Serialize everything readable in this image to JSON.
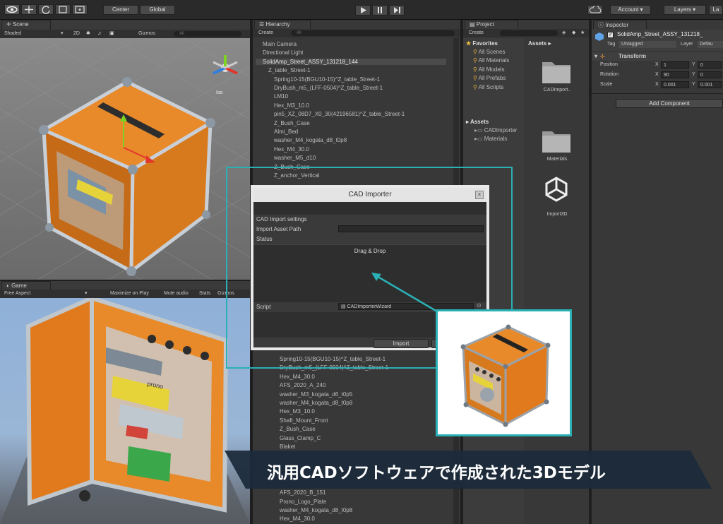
{
  "toolbar": {
    "pivot_label": "Center",
    "space_label": "Global",
    "account_label": "Account",
    "layers_label": "Layers",
    "layout_label": "La"
  },
  "scene": {
    "tab_label": "Scene",
    "shading_label": "Shaded",
    "mode_2d_label": "2D",
    "gizmos_label": "Gizmos",
    "search_placeholder": "All",
    "persp_label": "Iso"
  },
  "game": {
    "tab_label": "Game",
    "aspect_label": "Free Aspect",
    "maximize_label": "Maximize on Play",
    "mute_label": "Mute audio",
    "stats_label": "Stats",
    "gizmos_label": "Gizmos"
  },
  "hierarchy": {
    "tab_label": "Hierarchy",
    "create_label": "Create",
    "search_placeholder": "All",
    "items_top": [
      "Main Camera",
      "Directional Light",
      "SolidAmp_Street_ASSY_131218_144",
      "Z_table_Street-1",
      "Spring10-15(BGU10-15)^Z_table_Street-1",
      "DryBush_m5_(LFF-0504)^Z_table_Street-1",
      "LM10",
      "Hex_M3_10.0",
      "pin5_XZ_08D7_X0_30(42196581)^Z_table_Street-1",
      "Z_Bush_Case",
      "Almi_Bed",
      "washer_M4_kogata_d8_t0p8",
      "Hex_M4_30.0",
      "washer_M5_d10",
      "Z_Bush_Case",
      "Z_anchor_Vertical"
    ],
    "items_bottom": [
      "Spring10-15(BGU10-15)^Z_table_Street-1",
      "DryBush_m5_(LFF-0504)^Z_table_Street-1",
      "Hex_M4_30.0",
      "AFS_2020_A_240",
      "washer_M3_kogata_d6_t0p5",
      "washer_M4_kogata_d8_t0p8",
      "Hex_M3_10.0",
      "Shaft_Mount_Front",
      "Z_Bush_Case",
      "Glass_Clamp_C",
      "Blaket",
      "AFS_2020_B_151",
      "Prono_Logo_Plate",
      "washer_M4_kogata_d8_t0p8",
      "Hex_M4_30.0"
    ]
  },
  "project": {
    "tab_label": "Project",
    "create_label": "Create",
    "favorites_label": "Favorites",
    "favorites": [
      "All Scenes",
      "All Materials",
      "All Models",
      "All Prefabs",
      "All Scripts"
    ],
    "assets_label": "Assets",
    "assets_tree": [
      "CADImporter",
      "Materials"
    ],
    "assets_header": "Assets",
    "asset_items": [
      "CADImport..",
      "Materials",
      "Import3D"
    ]
  },
  "inspector": {
    "tab_label": "Inspector",
    "object_name": "SolidAmp_Street_ASSY_131218_",
    "tag_label": "Tag",
    "tag_value": "Untagged",
    "layer_label": "Layer",
    "layer_value": "Defau",
    "transform_label": "Transform",
    "rows": [
      {
        "label": "Position",
        "x": "1",
        "y": "0"
      },
      {
        "label": "Rotation",
        "x": "90",
        "y": "0"
      },
      {
        "label": "Scale",
        "x": "0.001",
        "y": "0.001"
      }
    ],
    "add_component_label": "Add Component"
  },
  "dialog": {
    "title": "CAD Importer",
    "settings_label": "CAD Import settings",
    "path_label": "Import Asset Path",
    "status_label": "Status",
    "drop_label": "Drag & Drop",
    "script_label": "Script",
    "script_value": "CADImporterWizard",
    "import_label": "Import"
  },
  "game_logo_text": "prono",
  "caption": "汎用CADソフトウェアで作成された3Dモデル",
  "colors": {
    "accent_teal": "#2ab0b5",
    "orange": "#e07a1c",
    "caption_bg": "#1b2a3a"
  }
}
